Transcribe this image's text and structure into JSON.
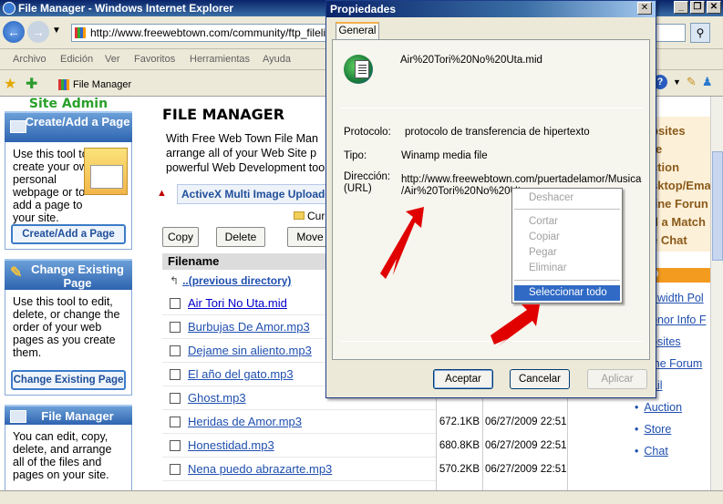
{
  "browser": {
    "title": "File Manager - Windows Internet Explorer",
    "address": "http://www.freewebtown.com/community/ftp_filelist.",
    "menu": [
      "Archivo",
      "Edición",
      "Ver",
      "Favoritos",
      "Herramientas",
      "Ayuda"
    ],
    "tab_title": "File Manager",
    "win_btns": [
      "_",
      "❐",
      "✕"
    ]
  },
  "sidebar": {
    "title": "Site Admin",
    "create": {
      "heading": "Create/Add a Page",
      "text": "Use this tool to create your own personal webpage or to add a page to your site.",
      "button": "Create/Add a Page"
    },
    "change": {
      "heading": "Change Existing Page",
      "text": "Use this tool to edit, delete, or change the order of your web pages as you create them.",
      "button": "Change Existing Page"
    },
    "filemanager": {
      "heading": "File Manager",
      "text": "You can edit, copy, delete, and arrange all of the files and pages on your site."
    }
  },
  "main": {
    "title": "FILE MANAGER",
    "intro": [
      "With Free Web Town File Man",
      "arrange all of your Web Site p",
      "powerful Web Development too"
    ],
    "activex_label": "ActiveX Multi Image Uploade",
    "current_dir": "Cur",
    "buttons": {
      "copy": "Copy",
      "delete": "Delete",
      "move": "Move"
    },
    "column_filename": "Filename",
    "parent_dir": "..(previous directory)",
    "files": [
      {
        "name": "Air Tori No Uta.mid",
        "size": "",
        "date": ""
      },
      {
        "name": "Burbujas De Amor.mp3",
        "size": "",
        "date": ""
      },
      {
        "name": "Dejame sin aliento.mp3",
        "size": "",
        "date": ""
      },
      {
        "name": "El año del gato.mp3",
        "size": "",
        "date": ""
      },
      {
        "name": "Ghost.mp3",
        "size": "",
        "date": ""
      },
      {
        "name": "Heridas de Amor.mp3",
        "size": "672.1KB",
        "date": "06/27/2009 22:51"
      },
      {
        "name": "Honestidad.mp3",
        "size": "680.8KB",
        "date": "06/27/2009 22:51"
      },
      {
        "name": "Nena puedo abrazarte.mp3",
        "size": "570.2KB",
        "date": "06/27/2009 22:51"
      }
    ]
  },
  "right_column": {
    "box": [
      "bsites",
      "re",
      "ction",
      "sktop/Ema",
      "line Forun",
      "d a Match",
      "e Chat"
    ],
    "orange": "O",
    "links1": [
      "dwidth Pol",
      "onor Info F",
      "bsites",
      "ine Forum",
      "ail"
    ],
    "links2": [
      "Auction",
      "Store",
      "Chat"
    ]
  },
  "dialog": {
    "title": "Propiedades",
    "tab": "General",
    "filename": "Air%20Tori%20No%20Uta.mid",
    "protocol_label": "Protocolo:",
    "protocol_value": "protocolo de transferencia de hipertexto",
    "type_label": "Tipo:",
    "type_value": "Winamp media file",
    "address_label": "Dirección:",
    "address_label2": "(URL)",
    "address_value1": "http://www.freewebtown.com/puertadelamor/Musica",
    "address_value2": "/Air%20Tori%20No%20Uta",
    "buttons": {
      "accept": "Aceptar",
      "cancel": "Cancelar",
      "apply": "Aplicar"
    }
  },
  "context_menu": {
    "items": [
      "Deshacer",
      "Cortar",
      "Copiar",
      "Pegar",
      "Eliminar",
      "Seleccionar todo"
    ]
  },
  "colors": {
    "titlebar": "#0a246a",
    "link": "#1f4faf",
    "sidebar_head": "#2e64b0",
    "highlight": "#316ac5",
    "arrow": "#e00000"
  }
}
